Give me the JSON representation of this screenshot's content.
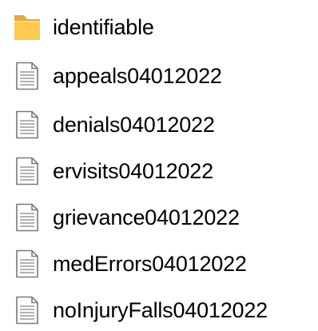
{
  "explorer": {
    "colors": {
      "folder_front": "#ffca4f",
      "folder_back": "#e8a93a",
      "doc_outline": "#7a7a7a",
      "doc_lines": "#9a9a9a",
      "text": "#000000"
    },
    "items": [
      {
        "name": "identifiable",
        "type": "folder",
        "icon": "folder-icon"
      },
      {
        "name": "appeals04012022",
        "type": "file",
        "icon": "text-document-icon"
      },
      {
        "name": "denials04012022",
        "type": "file",
        "icon": "text-document-icon"
      },
      {
        "name": "ervisits04012022",
        "type": "file",
        "icon": "text-document-icon"
      },
      {
        "name": "grievance04012022",
        "type": "file",
        "icon": "text-document-icon"
      },
      {
        "name": "medErrors04012022",
        "type": "file",
        "icon": "text-document-icon"
      },
      {
        "name": "noInjuryFalls04012022",
        "type": "file",
        "icon": "text-document-icon"
      }
    ]
  }
}
